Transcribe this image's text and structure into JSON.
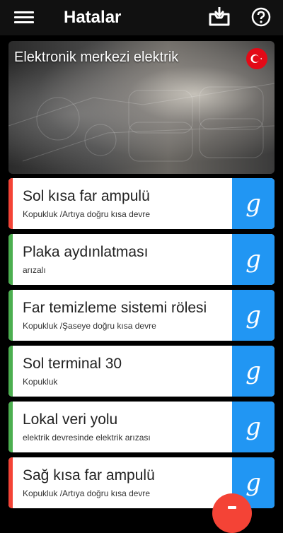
{
  "appbar": {
    "title": "Hatalar",
    "icons": {
      "menu": "menu-icon",
      "inbox": "inbox-download-icon",
      "help": "help-circle-icon"
    }
  },
  "hero": {
    "title": "Elektronik merkezi elektrik",
    "flag": "turkey-flag-icon"
  },
  "colors": {
    "red_accent": "#f44336",
    "green_accent": "#4caf50",
    "blue_button": "#2196f3"
  },
  "faults": [
    {
      "name": "Sol kısa far ampulü",
      "desc": "Kopukluk /Artıya doğru kısa devre",
      "status": "red"
    },
    {
      "name": "Plaka aydınlatması",
      "desc": "arızalı",
      "status": "green"
    },
    {
      "name": "Far temizleme sistemi rölesi",
      "desc": "Kopukluk /Şaseye doğru kısa devre",
      "status": "green"
    },
    {
      "name": "Sol terminal 30",
      "desc": "Kopukluk",
      "status": "green"
    },
    {
      "name": "Lokal veri yolu",
      "desc": "elektrik devresinde elektrik arızası",
      "status": "green"
    },
    {
      "name": "Sağ kısa far ampulü",
      "desc": "Kopukluk /Artıya doğru kısa devre",
      "status": "red"
    }
  ],
  "google_glyph": "g",
  "fab": {
    "icon": "delete-icon"
  }
}
